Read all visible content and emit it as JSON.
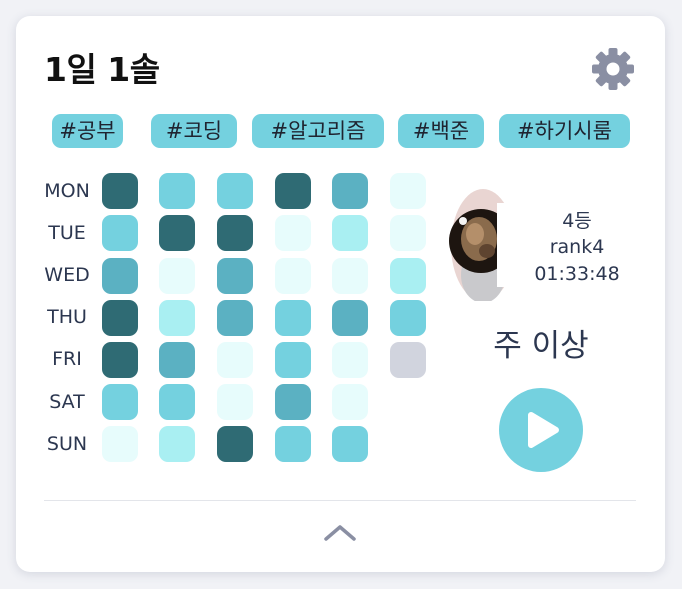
{
  "card": {
    "title": "1일 1솔"
  },
  "tags": [
    "#공부",
    "#코딩",
    "#알고리즘",
    "#백준",
    "#하기시룸"
  ],
  "heatmap": {
    "days": [
      "MON",
      "TUE",
      "WED",
      "THU",
      "FRI",
      "SAT",
      "SUN"
    ],
    "palette": {
      "0": "#e7fcfc",
      "1": "#a9eff2",
      "2": "#74d1df",
      "3": "#5bb1c2",
      "4": "#2f6b74",
      "future": "#d1d4de"
    },
    "weeks": [
      [
        4,
        2,
        3,
        4,
        4,
        2,
        0
      ],
      [
        2,
        4,
        0,
        1,
        3,
        2,
        1
      ],
      [
        2,
        4,
        3,
        3,
        0,
        0,
        4
      ],
      [
        4,
        0,
        0,
        2,
        2,
        3,
        2
      ],
      [
        3,
        1,
        0,
        3,
        0,
        0,
        2
      ],
      [
        0,
        0,
        1,
        2,
        "future"
      ]
    ]
  },
  "profile": {
    "rank": "4등",
    "name": "rank4",
    "time": "01:33:48",
    "level": "주 이상"
  },
  "colors": {
    "accent": "#74d1df",
    "icon": "#8a8fa3",
    "text": "#2c3750"
  },
  "icons": {
    "settings": "gear-icon",
    "play": "play-icon",
    "collapse": "chevron-up-icon"
  }
}
